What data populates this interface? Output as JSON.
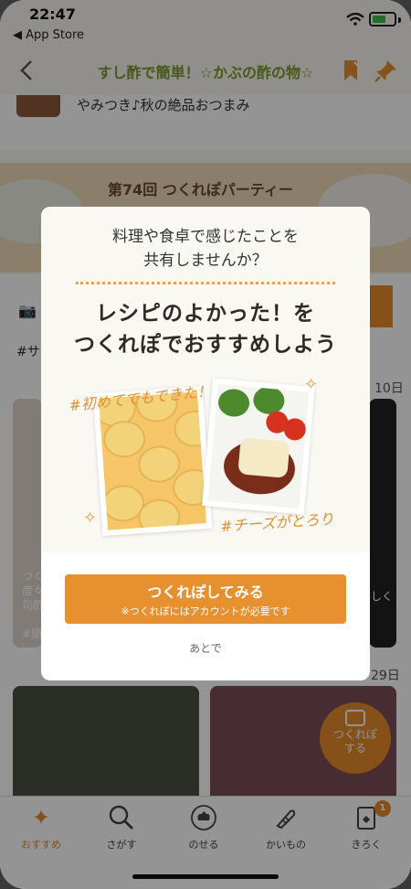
{
  "status_bar": {
    "time": "22:47",
    "back_app": "◀ App Store",
    "wifi_icon": "wifi-icon",
    "battery_icon": "battery-charging-icon"
  },
  "nav": {
    "title": "すし酢で簡単！☆かぶの酢の物☆",
    "back_icon": "chevron-left-icon",
    "bookmark_icon": "bookmark-icon",
    "pin_icon": "pin-icon",
    "accent": "#7a9a2a"
  },
  "background": {
    "row_text": "やみつき♪秋の絶品おつまみ",
    "banner_title": "第74回 つくれぽパーティー",
    "section_tag": "#サ",
    "date_right_top": "10日",
    "date_right_bottom": "29日",
    "card1_text": "つく\n度々\n司酢",
    "card1_hash": "#簡",
    "card2_text": "しく\n"
  },
  "float_camera": {
    "line1": "つくれぽ",
    "line2": "する"
  },
  "modal": {
    "question": "料理や食卓で感じたことを\n共有しませんか？",
    "headline": "レシピのよかった！を\nつくれぽでおすすめしよう",
    "hashtag_left": "#初めてでもできた！",
    "hashtag_right": "#チーズがとろり",
    "cta_label": "つくれぽしてみる",
    "cta_note": "※つくれぽにはアカウントが必要です",
    "later_label": "あとで",
    "accent": "#e7902f"
  },
  "tabs": [
    {
      "label": "おすすめ",
      "icon": "sparkle-icon",
      "active": true
    },
    {
      "label": "さがす",
      "icon": "search-icon",
      "active": false
    },
    {
      "label": "のせる",
      "icon": "chef-hat-icon",
      "active": false
    },
    {
      "label": "かいもの",
      "icon": "groceries-icon",
      "active": false
    },
    {
      "label": "きろく",
      "icon": "record-icon",
      "active": false,
      "badge": "1"
    }
  ]
}
